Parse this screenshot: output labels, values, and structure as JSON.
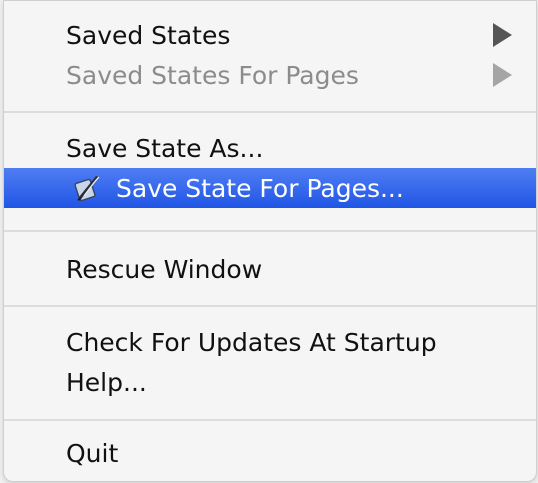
{
  "menu": {
    "items": [
      {
        "label": "Saved States",
        "icon": "chevron-right-icon"
      },
      {
        "label": "Saved States For Pages",
        "icon": "chevron-right-icon"
      },
      {
        "label": "Save State As..."
      },
      {
        "label": "Save State For Pages...",
        "icon": "pages-quill-icon"
      },
      {
        "label": "Rescue Window"
      },
      {
        "label": "Check For Updates At Startup"
      },
      {
        "label": "Help..."
      },
      {
        "label": "Quit"
      }
    ]
  },
  "colors": {
    "selected_bg": "#2c62ea",
    "selected_text": "#ffffff",
    "disabled_text": "#8c8c8c",
    "menu_bg": "#f5f5f5"
  }
}
